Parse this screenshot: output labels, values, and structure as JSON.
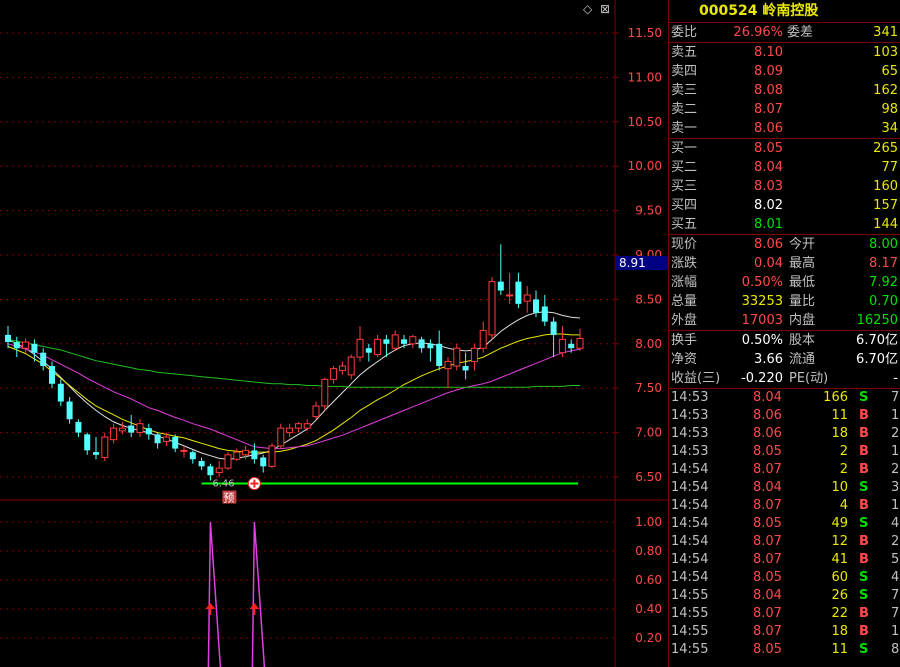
{
  "top_icons": {
    "diamond": "◇",
    "close": "⊠"
  },
  "price_axis": [
    "11.50",
    "11.00",
    "10.50",
    "10.00",
    "9.50",
    "9.00",
    "8.50",
    "8.00",
    "7.50",
    "7.00",
    "6.50"
  ],
  "price_marker": "8.91",
  "low_label": "6.46",
  "pre_label": "预",
  "indicator_axis": [
    "1.00",
    "0.80",
    "0.60",
    "0.40",
    "0.20"
  ],
  "stock": {
    "code": "000524",
    "name": "岭南控股"
  },
  "order_summary": {
    "ratio_label": "委比",
    "ratio": "26.96%",
    "diff_label": "委差",
    "diff": "341"
  },
  "asks": [
    {
      "label": "卖五",
      "price": "8.10",
      "vol": "103"
    },
    {
      "label": "卖四",
      "price": "8.09",
      "vol": "65"
    },
    {
      "label": "卖三",
      "price": "8.08",
      "vol": "162"
    },
    {
      "label": "卖二",
      "price": "8.07",
      "vol": "98"
    },
    {
      "label": "卖一",
      "price": "8.06",
      "vol": "34"
    }
  ],
  "bids": [
    {
      "label": "买一",
      "price": "8.05",
      "vol": "265",
      "color": "red"
    },
    {
      "label": "买二",
      "price": "8.04",
      "vol": "77",
      "color": "red"
    },
    {
      "label": "买三",
      "price": "8.03",
      "vol": "160",
      "color": "red"
    },
    {
      "label": "买四",
      "price": "8.02",
      "vol": "157",
      "color": "white"
    },
    {
      "label": "买五",
      "price": "8.01",
      "vol": "144",
      "color": "green"
    }
  ],
  "quote": [
    {
      "l1": "现价",
      "v1": "8.06",
      "c1": "red",
      "l2": "今开",
      "v2": "8.00",
      "c2": "green"
    },
    {
      "l1": "涨跌",
      "v1": "0.04",
      "c1": "red",
      "l2": "最高",
      "v2": "8.17",
      "c2": "red"
    },
    {
      "l1": "涨幅",
      "v1": "0.50%",
      "c1": "red",
      "l2": "最低",
      "v2": "7.92",
      "c2": "green"
    },
    {
      "l1": "总量",
      "v1": "33253",
      "c1": "yellow",
      "l2": "量比",
      "v2": "0.70",
      "c2": "green"
    },
    {
      "l1": "外盘",
      "v1": "17003",
      "c1": "red",
      "l2": "内盘",
      "v2": "16250",
      "c2": "green"
    }
  ],
  "fundamentals": [
    {
      "l1": "换手",
      "v1": "0.50%",
      "l2": "股本",
      "v2": "6.70亿"
    },
    {
      "l1": "净资",
      "v1": "3.66",
      "l2": "流通",
      "v2": "6.70亿"
    },
    {
      "l1": "收益(三)",
      "v1": "-0.220",
      "l2": "PE(动)",
      "v2": "-"
    }
  ],
  "ticks": [
    {
      "time": "14:53",
      "price": "8.04",
      "pc": "red",
      "vol": "166",
      "bs": "S",
      "n": "7"
    },
    {
      "time": "14:53",
      "price": "8.06",
      "pc": "red",
      "vol": "11",
      "bs": "B",
      "n": "1"
    },
    {
      "time": "14:53",
      "price": "8.06",
      "pc": "red",
      "vol": "18",
      "bs": "B",
      "n": "2"
    },
    {
      "time": "14:53",
      "price": "8.05",
      "pc": "red",
      "vol": "2",
      "bs": "B",
      "n": "1"
    },
    {
      "time": "14:54",
      "price": "8.07",
      "pc": "red",
      "vol": "2",
      "bs": "B",
      "n": "2"
    },
    {
      "time": "14:54",
      "price": "8.04",
      "pc": "red",
      "vol": "10",
      "bs": "S",
      "n": "3"
    },
    {
      "time": "14:54",
      "price": "8.07",
      "pc": "red",
      "vol": "4",
      "bs": "B",
      "n": "1"
    },
    {
      "time": "14:54",
      "price": "8.05",
      "pc": "red",
      "vol": "49",
      "bs": "S",
      "n": "4"
    },
    {
      "time": "14:54",
      "price": "8.07",
      "pc": "red",
      "vol": "12",
      "bs": "B",
      "n": "2"
    },
    {
      "time": "14:54",
      "price": "8.07",
      "pc": "red",
      "vol": "41",
      "bs": "B",
      "n": "5"
    },
    {
      "time": "14:54",
      "price": "8.05",
      "pc": "red",
      "vol": "60",
      "bs": "S",
      "n": "4"
    },
    {
      "time": "14:55",
      "price": "8.04",
      "pc": "red",
      "vol": "26",
      "bs": "S",
      "n": "7"
    },
    {
      "time": "14:55",
      "price": "8.07",
      "pc": "red",
      "vol": "22",
      "bs": "B",
      "n": "7"
    },
    {
      "time": "14:55",
      "price": "8.07",
      "pc": "red",
      "vol": "18",
      "bs": "B",
      "n": "1"
    },
    {
      "time": "14:55",
      "price": "8.05",
      "pc": "red",
      "vol": "11",
      "bs": "S",
      "n": "8"
    }
  ],
  "candles": [
    [
      8.1,
      8.02,
      8.2,
      7.95
    ],
    [
      8.02,
      7.95,
      8.08,
      7.85
    ],
    [
      7.95,
      8.02,
      8.06,
      7.9
    ],
    [
      8.0,
      7.9,
      8.05,
      7.8
    ],
    [
      7.9,
      7.75,
      7.95,
      7.7
    ],
    [
      7.75,
      7.55,
      7.8,
      7.5
    ],
    [
      7.55,
      7.35,
      7.6,
      7.3
    ],
    [
      7.35,
      7.15,
      7.4,
      7.1
    ],
    [
      7.12,
      7.0,
      7.15,
      6.95
    ],
    [
      6.98,
      6.8,
      7.0,
      6.75
    ],
    [
      6.78,
      6.75,
      6.95,
      6.7
    ],
    [
      6.72,
      6.95,
      7.0,
      6.68
    ],
    [
      6.92,
      7.05,
      7.1,
      6.88
    ],
    [
      7.02,
      7.05,
      7.12,
      6.98
    ],
    [
      7.08,
      7.0,
      7.2,
      6.95
    ],
    [
      7.0,
      7.1,
      7.15,
      6.95
    ],
    [
      7.05,
      6.98,
      7.1,
      6.92
    ],
    [
      6.98,
      6.88,
      7.0,
      6.82
    ],
    [
      6.9,
      6.95,
      7.0,
      6.85
    ],
    [
      6.95,
      6.82,
      6.98,
      6.78
    ],
    [
      6.8,
      6.8,
      6.85,
      6.72
    ],
    [
      6.78,
      6.7,
      6.8,
      6.65
    ],
    [
      6.68,
      6.62,
      6.72,
      6.58
    ],
    [
      6.62,
      6.52,
      6.65,
      6.46
    ],
    [
      6.55,
      6.6,
      6.68,
      6.5
    ],
    [
      6.6,
      6.75,
      6.78,
      6.58
    ],
    [
      6.7,
      6.78,
      6.82,
      6.68
    ],
    [
      6.75,
      6.8,
      6.85,
      6.7
    ],
    [
      6.8,
      6.7,
      6.88,
      6.65
    ],
    [
      6.72,
      6.62,
      6.75,
      6.55
    ],
    [
      6.62,
      6.85,
      6.88,
      6.6
    ],
    [
      6.85,
      7.05,
      7.1,
      6.82
    ],
    [
      7.0,
      7.05,
      7.1,
      6.95
    ],
    [
      7.05,
      7.1,
      7.12,
      7.0
    ],
    [
      7.05,
      7.1,
      7.15,
      7.02
    ],
    [
      7.18,
      7.3,
      7.35,
      7.15
    ],
    [
      7.3,
      7.6,
      7.62,
      7.25
    ],
    [
      7.6,
      7.72,
      7.75,
      7.55
    ],
    [
      7.7,
      7.75,
      7.8,
      7.65
    ],
    [
      7.65,
      7.85,
      7.88,
      7.6
    ],
    [
      7.85,
      8.05,
      8.2,
      7.8
    ],
    [
      7.95,
      7.9,
      8.0,
      7.8
    ],
    [
      7.88,
      8.05,
      8.1,
      7.85
    ],
    [
      8.05,
      8.0,
      8.1,
      7.85
    ],
    [
      7.95,
      8.1,
      8.15,
      7.92
    ],
    [
      8.05,
      8.0,
      8.1,
      7.95
    ],
    [
      8.0,
      8.08,
      8.1,
      7.95
    ],
    [
      8.05,
      7.95,
      8.08,
      7.9
    ],
    [
      8.0,
      7.95,
      8.05,
      7.8
    ],
    [
      8.0,
      7.75,
      8.15,
      7.7
    ],
    [
      7.72,
      7.8,
      7.85,
      7.5
    ],
    [
      7.75,
      7.95,
      8.0,
      7.7
    ],
    [
      7.75,
      7.7,
      7.9,
      7.6
    ],
    [
      7.8,
      7.95,
      8.0,
      7.7
    ],
    [
      7.95,
      8.15,
      8.25,
      7.9
    ],
    [
      8.1,
      8.7,
      8.75,
      8.05
    ],
    [
      8.7,
      8.6,
      9.12,
      8.55
    ],
    [
      8.55,
      8.55,
      8.8,
      8.45
    ],
    [
      8.7,
      8.45,
      8.8,
      8.4
    ],
    [
      8.48,
      8.55,
      8.65,
      8.35
    ],
    [
      8.5,
      8.35,
      8.6,
      8.3
    ],
    [
      8.42,
      8.25,
      8.55,
      8.2
    ],
    [
      8.25,
      8.1,
      8.3,
      7.85
    ],
    [
      7.9,
      8.05,
      8.2,
      7.85
    ],
    [
      8.0,
      7.95,
      8.05,
      7.9
    ],
    [
      7.95,
      8.06,
      8.17,
      7.92
    ]
  ],
  "ma_lines": {
    "white": [
      8.05,
      8.0,
      7.95,
      7.88,
      7.8,
      7.72,
      7.62,
      7.52,
      7.42,
      7.33,
      7.25,
      7.18,
      7.12,
      7.08,
      7.05,
      7.02,
      7.0,
      6.96,
      6.93,
      6.89,
      6.85,
      6.81,
      6.77,
      6.74,
      6.71,
      6.7,
      6.71,
      6.73,
      6.75,
      6.77,
      6.8,
      6.86,
      6.92,
      6.98,
      7.04,
      7.14,
      7.25,
      7.35,
      7.45,
      7.55,
      7.65,
      7.73,
      7.8,
      7.87,
      7.93,
      7.98,
      8.0,
      8.01,
      8.0,
      7.98,
      7.95,
      7.93,
      7.92,
      7.93,
      7.96,
      8.05,
      8.14,
      8.21,
      8.27,
      8.32,
      8.35,
      8.36,
      8.35,
      8.32,
      8.3,
      8.29
    ],
    "yellow": [
      7.97,
      7.93,
      7.89,
      7.83,
      7.77,
      7.69,
      7.61,
      7.53,
      7.45,
      7.37,
      7.3,
      7.25,
      7.2,
      7.15,
      7.11,
      7.07,
      7.03,
      7.0,
      6.98,
      6.96,
      6.94,
      6.91,
      6.88,
      6.85,
      6.82,
      6.8,
      6.79,
      6.78,
      6.78,
      6.78,
      6.78,
      6.79,
      6.81,
      6.84,
      6.87,
      6.91,
      6.97,
      7.03,
      7.1,
      7.17,
      7.25,
      7.31,
      7.37,
      7.42,
      7.48,
      7.54,
      7.59,
      7.64,
      7.68,
      7.72,
      7.75,
      7.78,
      7.8,
      7.82,
      7.85,
      7.9,
      7.95,
      7.99,
      8.03,
      8.06,
      8.08,
      8.1,
      8.11,
      8.11,
      8.1,
      8.1
    ],
    "magenta": [
      8.0,
      7.97,
      7.94,
      7.91,
      7.87,
      7.82,
      7.77,
      7.72,
      7.67,
      7.61,
      7.56,
      7.51,
      7.46,
      7.42,
      7.38,
      7.33,
      7.28,
      7.25,
      7.21,
      7.17,
      7.14,
      7.1,
      7.07,
      7.04,
      7.0,
      6.96,
      6.92,
      6.88,
      6.84,
      6.83,
      6.82,
      6.82,
      6.83,
      6.84,
      6.85,
      6.88,
      6.91,
      6.94,
      6.97,
      7.01,
      7.05,
      7.09,
      7.13,
      7.17,
      7.21,
      7.25,
      7.29,
      7.33,
      7.37,
      7.41,
      7.45,
      7.48,
      7.51,
      7.53,
      7.55,
      7.58,
      7.62,
      7.66,
      7.7,
      7.74,
      7.78,
      7.82,
      7.86,
      7.9,
      7.92,
      7.94
    ],
    "green": [
      8.05,
      8.03,
      8.01,
      7.99,
      7.97,
      7.95,
      7.93,
      7.9,
      7.87,
      7.84,
      7.81,
      7.79,
      7.77,
      7.75,
      7.73,
      7.71,
      7.7,
      7.68,
      7.67,
      7.66,
      7.65,
      7.64,
      7.63,
      7.62,
      7.61,
      7.6,
      7.59,
      7.58,
      7.57,
      7.56,
      7.55,
      7.55,
      7.54,
      7.54,
      7.53,
      7.53,
      7.52,
      7.52,
      7.52,
      7.51,
      7.51,
      7.51,
      7.51,
      7.51,
      7.51,
      7.51,
      7.51,
      7.51,
      7.51,
      7.51,
      7.51,
      7.51,
      7.51,
      7.51,
      7.51,
      7.51,
      7.51,
      7.51,
      7.51,
      7.51,
      7.52,
      7.52,
      7.52,
      7.52,
      7.53,
      7.53
    ]
  },
  "support_level": 6.46,
  "indicator": {
    "spikes_at": [
      23,
      28
    ],
    "arrows_at": [
      23,
      28
    ]
  }
}
